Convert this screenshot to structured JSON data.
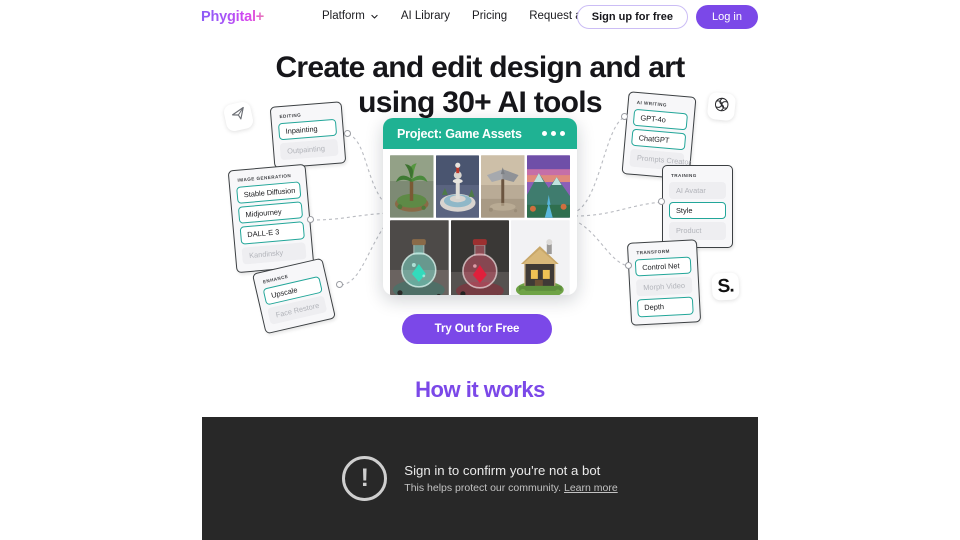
{
  "header": {
    "logo": "Phygital+",
    "nav": [
      {
        "label": "Platform",
        "icon": "chevron-down-icon",
        "has_chevron": true
      },
      {
        "label": "AI Library",
        "has_chevron": false
      },
      {
        "label": "Pricing",
        "has_chevron": false
      },
      {
        "label": "Request a demo",
        "has_chevron": false
      }
    ],
    "signup_label": "Sign up for free",
    "login_label": "Log in"
  },
  "hero": {
    "title_line1": "Create and edit design and art",
    "title_line2": "using 30+ AI tools",
    "cta_label": "Try Out for Free"
  },
  "diagram": {
    "cards": [
      {
        "id": "editing",
        "title": "EDITING",
        "items": [
          {
            "label": "Inpainting",
            "selected": true
          },
          {
            "label": "Outpainting",
            "selected": false
          }
        ]
      },
      {
        "id": "image-generation",
        "title": "IMAGE GENERATION",
        "items": [
          {
            "label": "Stable Diffusion",
            "selected": true
          },
          {
            "label": "Midjourney",
            "selected": true
          },
          {
            "label": "DALL-E 3",
            "selected": true
          },
          {
            "label": "Kandinsky",
            "selected": false
          }
        ]
      },
      {
        "id": "enhance",
        "title": "ENHANCE",
        "items": [
          {
            "label": "Upscale",
            "selected": true
          },
          {
            "label": "Face Restore",
            "selected": false
          }
        ]
      },
      {
        "id": "ai-writing",
        "title": "AI WRITING",
        "items": [
          {
            "label": "GPT-4o",
            "selected": true
          },
          {
            "label": "ChatGPT",
            "selected": true
          },
          {
            "label": "Prompts Creator",
            "selected": false
          }
        ]
      },
      {
        "id": "training",
        "title": "TRAINING",
        "items": [
          {
            "label": "AI Avatar",
            "selected": false
          },
          {
            "label": "Style",
            "selected": true
          },
          {
            "label": "Product",
            "selected": false
          }
        ]
      },
      {
        "id": "transform",
        "title": "TRANSFORM",
        "items": [
          {
            "label": "Control Net",
            "selected": true
          },
          {
            "label": "Morph Video",
            "selected": false
          },
          {
            "label": "Depth",
            "selected": true
          }
        ]
      }
    ],
    "badges": [
      {
        "id": "telegram-badge",
        "icon": "paper-plane-icon"
      },
      {
        "id": "openai-badge",
        "icon": "openai-icon"
      },
      {
        "id": "stability-badge",
        "icon": "stability-s-icon",
        "text": "S."
      }
    ],
    "project": {
      "title": "Project: Game Assets",
      "menu_icon": "three-dots-icon",
      "thumbnails": [
        "palm-tree-island",
        "fountain-statue",
        "battle-axe",
        "pixel-mountains",
        "teal-potion-bottle",
        "red-potion-bottle",
        "wooden-cottage"
      ]
    }
  },
  "how_it_works": {
    "heading": "How it works"
  },
  "video_gate": {
    "title": "Sign in to confirm you're not a bot",
    "subtitle": "This helps protect our community.",
    "link_label": "Learn more",
    "icon": "exclamation-circle-icon",
    "background_color": "#282828"
  },
  "colors": {
    "brand_purple": "#7b48e8",
    "accent_teal": "#1fb293",
    "chip_border_teal": "#22a699",
    "text_dark": "#16161a"
  }
}
